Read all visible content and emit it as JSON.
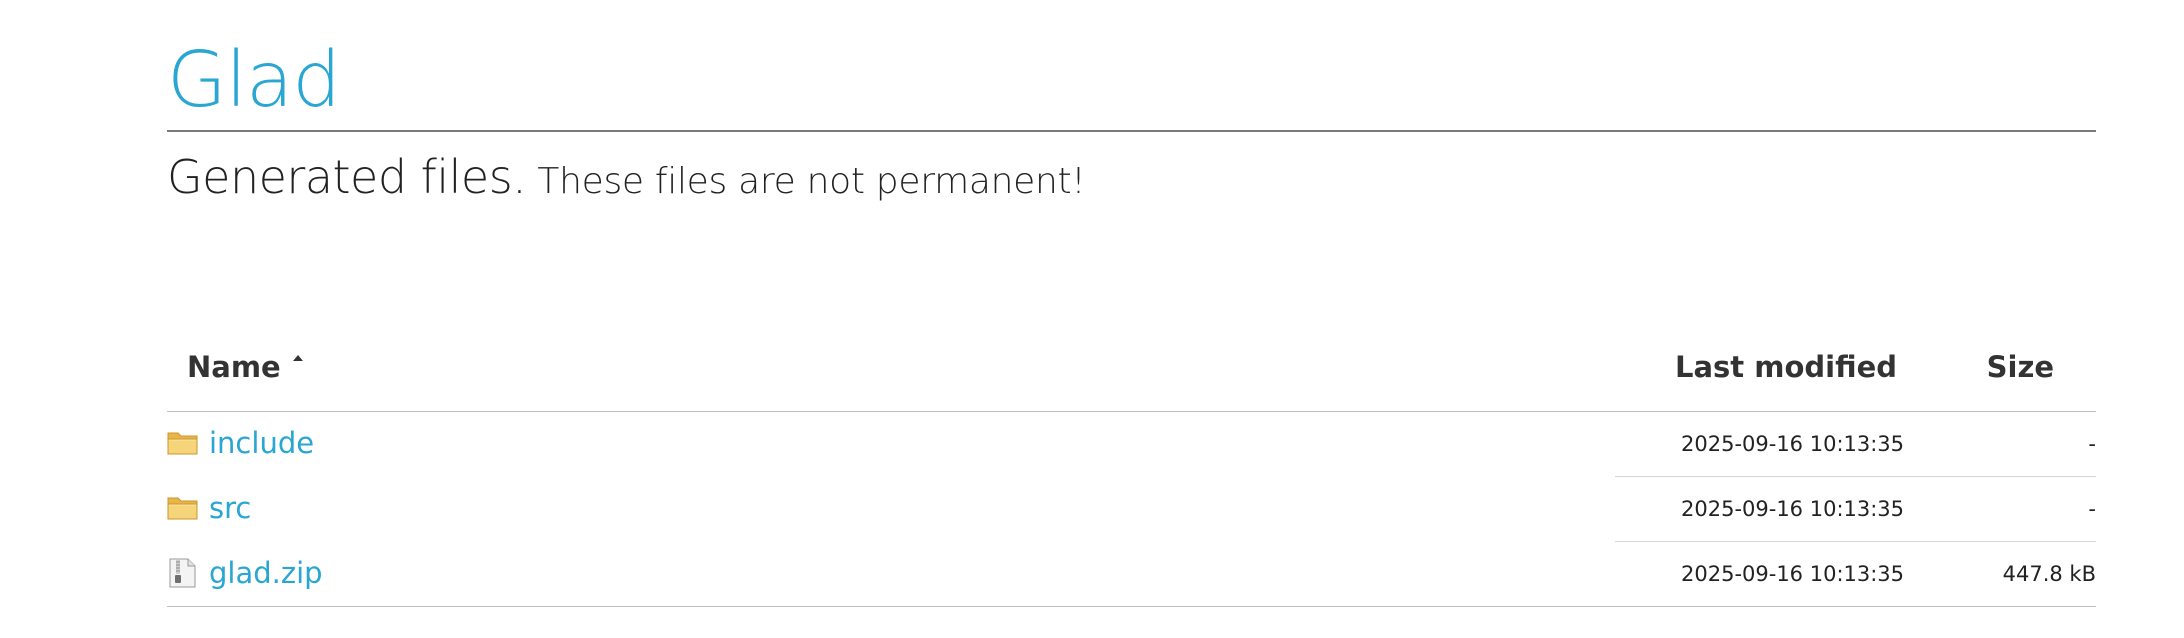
{
  "header": {
    "title": "Glad",
    "subtitle_main": "Generated files.",
    "subtitle_note": "These files are not permanent!"
  },
  "table": {
    "columns": {
      "name": "Name",
      "modified": "Last modified",
      "size": "Size"
    },
    "sort": {
      "column": "name",
      "direction": "ascending"
    },
    "rows": [
      {
        "name": "include",
        "type": "folder",
        "icon": "folder-icon",
        "modified": "2025-09-16 10:13:35",
        "size": "-"
      },
      {
        "name": "src",
        "type": "folder",
        "icon": "folder-icon",
        "modified": "2025-09-16 10:13:35",
        "size": "-"
      },
      {
        "name": "glad.zip",
        "type": "archive",
        "icon": "zip-file-icon",
        "modified": "2025-09-16 10:13:35",
        "size": "447.8 kB"
      }
    ]
  },
  "colors": {
    "accent": "#29a6d2",
    "folder": "#f2c75c",
    "text": "#222222"
  }
}
